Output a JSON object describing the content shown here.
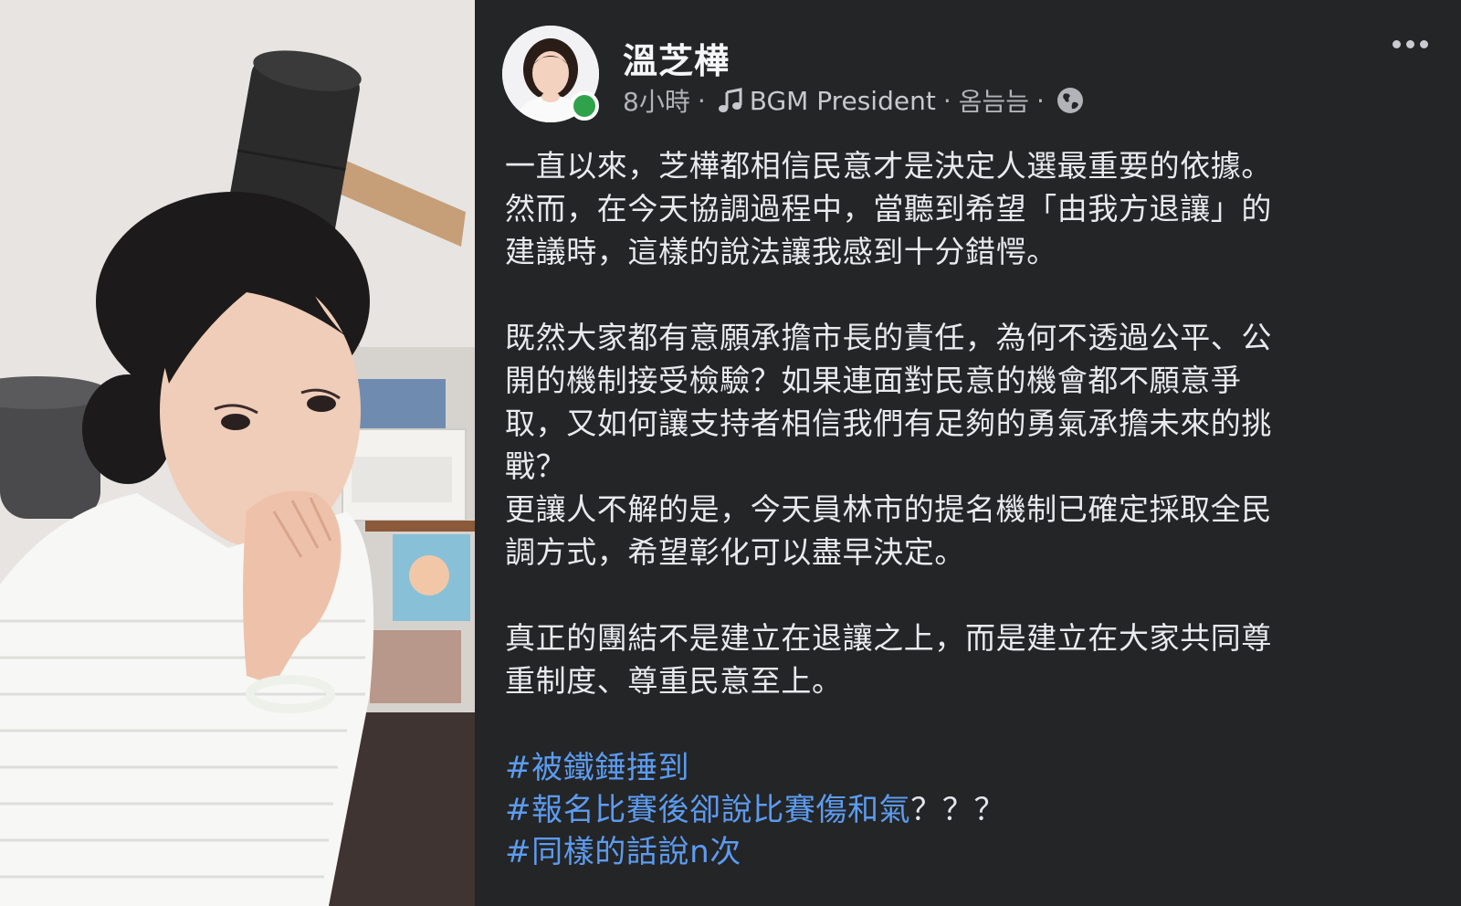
{
  "post": {
    "author": "溫芝樺",
    "time": "8小時",
    "music_label": "BGM President",
    "music_artist": "옴늠늠",
    "paragraphs": [
      [
        "一直以來，芝樺都相信民意才是決定人選最重要的依據。",
        "然而，在今天協調過程中，當聽到希望「由我方退讓」的",
        "建議時，這樣的說法讓我感到十分錯愕。"
      ],
      [
        "既然大家都有意願承擔市長的責任，為何不透過公平、公",
        "開的機制接受檢驗？如果連面對民意的機會都不願意爭",
        "取，又如何讓支持者相信我們有足夠的勇氣承擔未來的挑",
        "戰？",
        "更讓人不解的是，今天員林市的提名機制已確定採取全民",
        "調方式，希望彰化可以盡早決定。"
      ],
      [
        "真正的團結不是建立在退讓之上，而是建立在大家共同尊",
        "重制度、尊重民意至上。"
      ]
    ],
    "hashtags": [
      {
        "tag": "#被鐵錘捶到",
        "suffix": ""
      },
      {
        "tag": "#報名比賽後卻說比賽傷和氣",
        "suffix": "？？？"
      },
      {
        "tag": "#同樣的話說n次",
        "suffix": ""
      }
    ]
  },
  "colors": {
    "background": "#242526",
    "text": "#e4e6eb",
    "muted": "#b0b3b8",
    "hashtag": "#5c9bf0",
    "online": "#31a24c"
  },
  "icons": {
    "more": "more-horizontal-icon",
    "music": "music-note-icon",
    "privacy": "globe-icon"
  }
}
